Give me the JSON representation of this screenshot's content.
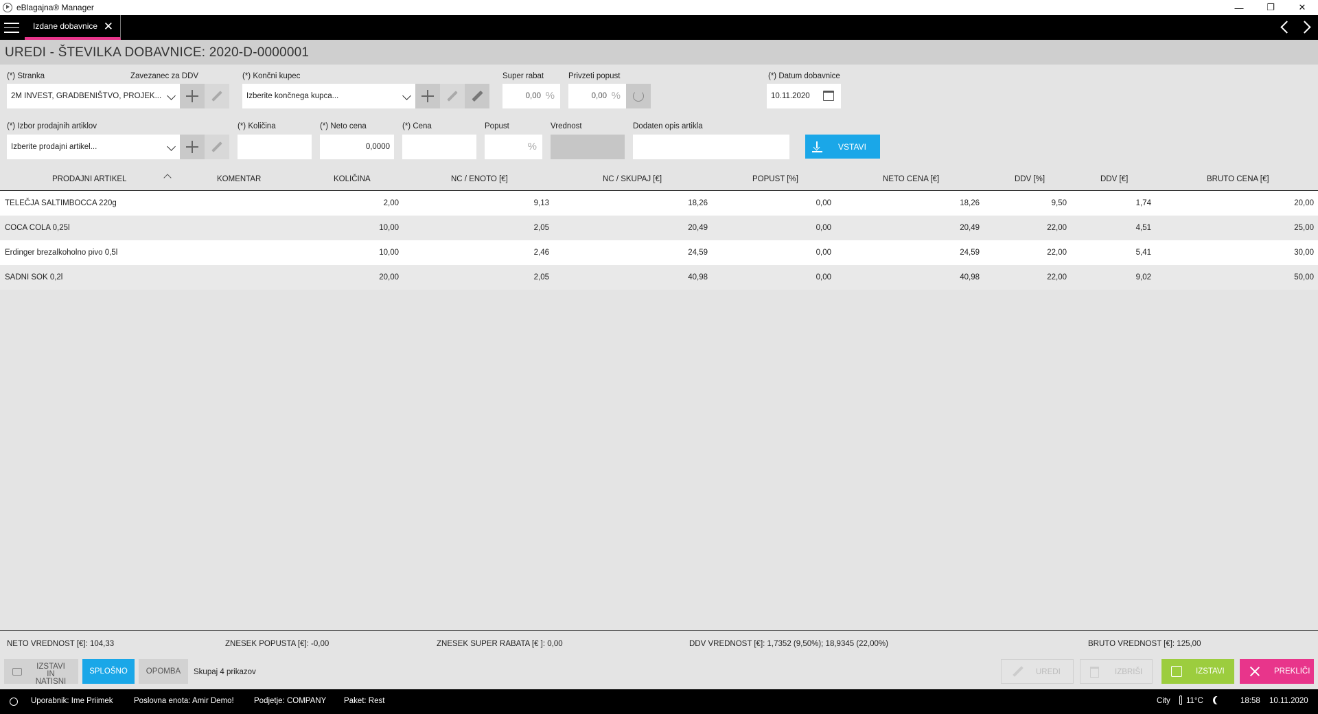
{
  "window": {
    "title": "eBlagajna® Manager",
    "min": "—",
    "restore": "❐",
    "close": "✕"
  },
  "tabs": [
    {
      "label": "Izdane dobavnice"
    }
  ],
  "page_title": "UREDI - ŠTEVILKA DOBAVNICE: 2020-D-0000001",
  "form": {
    "stranka_label": "(*) Stranka",
    "zavezanec_label": "Zavezanec za DDV",
    "stranka_value": "2M INVEST, GRADBENIŠTVO, PROJEK...",
    "koncni_kupec_label": "(*) Končni kupec",
    "koncni_kupec_placeholder": "Izberite končnega kupca...",
    "super_rabat_label": "Super rabat",
    "super_rabat_value": "0,00",
    "privzeti_popust_label": "Privzeti popust",
    "privzeti_popust_value": "0,00",
    "percent": "%",
    "datum_label": "(*) Datum dobavnice",
    "datum_value": "10.11.2020",
    "izbor_label": "(*) Izbor prodajnih artiklov",
    "izbor_placeholder": "Izberite prodajni artikel...",
    "kolicina_label": "(*) Količina",
    "neto_cena_label": "(*) Neto cena",
    "neto_cena_value": "0,0000",
    "cena_label": "(*) Cena",
    "popust_label": "Popust",
    "vrednost_label": "Vrednost",
    "opis_label": "Dodaten opis artikla",
    "insert_button": "VSTAVI"
  },
  "table": {
    "columns": [
      "PRODAJNI ARTIKEL",
      "KOMENTAR",
      "KOLIČINA",
      "NC / ENOTO [€]",
      "NC / SKUPAJ [€]",
      "POPUST [%]",
      "NETO CENA [€]",
      "DDV [%]",
      "DDV [€]",
      "BRUTO CENA [€]"
    ],
    "rows": [
      {
        "artikel": "TELEČJA SALTIMBOCCA 220g",
        "komentar": "",
        "kolicina": "2,00",
        "nc_enoto": "9,13",
        "nc_skupaj": "18,26",
        "popust": "0,00",
        "neto": "18,26",
        "ddv_pct": "9,50",
        "ddv_eur": "1,74",
        "bruto": "20,00"
      },
      {
        "artikel": "COCA COLA 0,25l",
        "komentar": "",
        "kolicina": "10,00",
        "nc_enoto": "2,05",
        "nc_skupaj": "20,49",
        "popust": "0,00",
        "neto": "20,49",
        "ddv_pct": "22,00",
        "ddv_eur": "4,51",
        "bruto": "25,00"
      },
      {
        "artikel": "Erdinger brezalkoholno pivo 0,5l",
        "komentar": "",
        "kolicina": "10,00",
        "nc_enoto": "2,46",
        "nc_skupaj": "24,59",
        "popust": "0,00",
        "neto": "24,59",
        "ddv_pct": "22,00",
        "ddv_eur": "5,41",
        "bruto": "30,00"
      },
      {
        "artikel": "SADNI SOK 0,2l",
        "komentar": "",
        "kolicina": "20,00",
        "nc_enoto": "2,05",
        "nc_skupaj": "40,98",
        "popust": "0,00",
        "neto": "40,98",
        "ddv_pct": "22,00",
        "ddv_eur": "9,02",
        "bruto": "50,00"
      }
    ]
  },
  "totals": {
    "neto": "NETO VREDNOST [€]: 104,33",
    "popust": "ZNESEK POPUSTA [€]: -0,00",
    "super_rabat": "ZNESEK SUPER RABATA [€ ]: 0,00",
    "ddv": "DDV VREDNOST [€]: 1,7352 (9,50%); 18,9345 (22,00%)",
    "bruto": "BRUTO VREDNOST [€]: 125,00"
  },
  "actions": {
    "print": "IZSTAVI IN NATISNI",
    "general": "SPLOŠNO",
    "note": "OPOMBA",
    "count": "Skupaj 4 prikazov",
    "edit": "UREDI",
    "delete": "IZBRIŠI",
    "issue": "IZSTAVI",
    "cancel": "PREKLIČI"
  },
  "status": {
    "user": "Uporabnik: Ime Priimek",
    "unit": "Poslovna enota: Amir Demo!",
    "company": "Podjetje: COMPANY",
    "package": "Paket: Rest",
    "city": "City",
    "temp": "11°C",
    "time": "18:58",
    "date": "10.11.2020"
  },
  "colors": {
    "accent_blue": "#1aa7e8",
    "accent_pink": "#e8358b",
    "accent_green": "#9ccd3e"
  }
}
